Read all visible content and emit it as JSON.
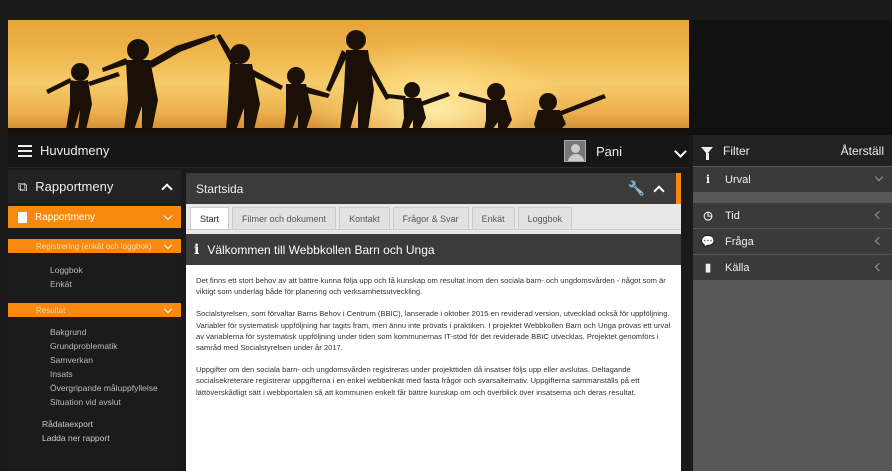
{
  "topbar": {
    "menu_label": "Huvudmeny",
    "user_name": "Pani"
  },
  "filter": {
    "title": "Filter",
    "reset": "Återställ",
    "rows": [
      {
        "label": "Urval",
        "icon": "info-icon"
      },
      {
        "label": "Tid",
        "icon": "clock-icon"
      },
      {
        "label": "Fråga",
        "icon": "chat-icon"
      },
      {
        "label": "Källa",
        "icon": "book-icon"
      }
    ]
  },
  "sidebar": {
    "title": "Rapportmeny",
    "active": "Rapportmeny",
    "sections": [
      {
        "title": "Registrering (enkät och loggbok)",
        "items": [
          "Loggbok",
          "Enkät"
        ]
      },
      {
        "title": "Resultat",
        "items": [
          "Bakgrund",
          "Grundproblematik",
          "Samverkan",
          "Insats",
          "Övergripande måluppfyllelse",
          "Situation vid avslut"
        ]
      }
    ],
    "footer_items": [
      "Rådataexport",
      "Ladda ner rapport"
    ]
  },
  "content": {
    "title": "Startsida",
    "tabs": [
      "Start",
      "Filmer och dokument",
      "Kontakt",
      "Frågor & Svar",
      "Enkät",
      "Loggbok"
    ],
    "welcome": "Välkommen till Webbkollen Barn och Unga",
    "paragraphs": [
      "Det finns ett stort behov av att bättre kunna följa upp och få kunskap om resultat inom den sociala barn- och ungdomsvården - något som är viktigt som underlag både för planering och verksamhetsutveckling.",
      "Socialstyrelsen, som förvaltar Barns Behov i Centrum (BBIC), lanserade i oktober 2015 en reviderad version, utvecklad också för uppföljning. Variabler för systematisk uppföljning har tagits fram, men ännu inte prövats i praktiken. I projektet Webbkollen Barn och Unga prövas ett urval av variablerna för systematisk uppföljning under tiden som kommunernas IT-stöd för det reviderade BBIC utvecklas. Projektet genomförs i samråd med Socialstyrelsen under år 2017.",
      "Uppgifter om den sociala barn- och ungdomsvården registreras under projekttiden då insatser följs upp eller avslutas. Deltagande socialsekreterare registrerar uppgifterna i en enkel webbenkät med fasta frågor och svarsalternativ. Uppgifterna sammanställs på ett lättöverskådligt sätt i webbportalen så att kommunen enkelt får bättre kunskap om och överblick över insatserna och deras resultat."
    ]
  }
}
